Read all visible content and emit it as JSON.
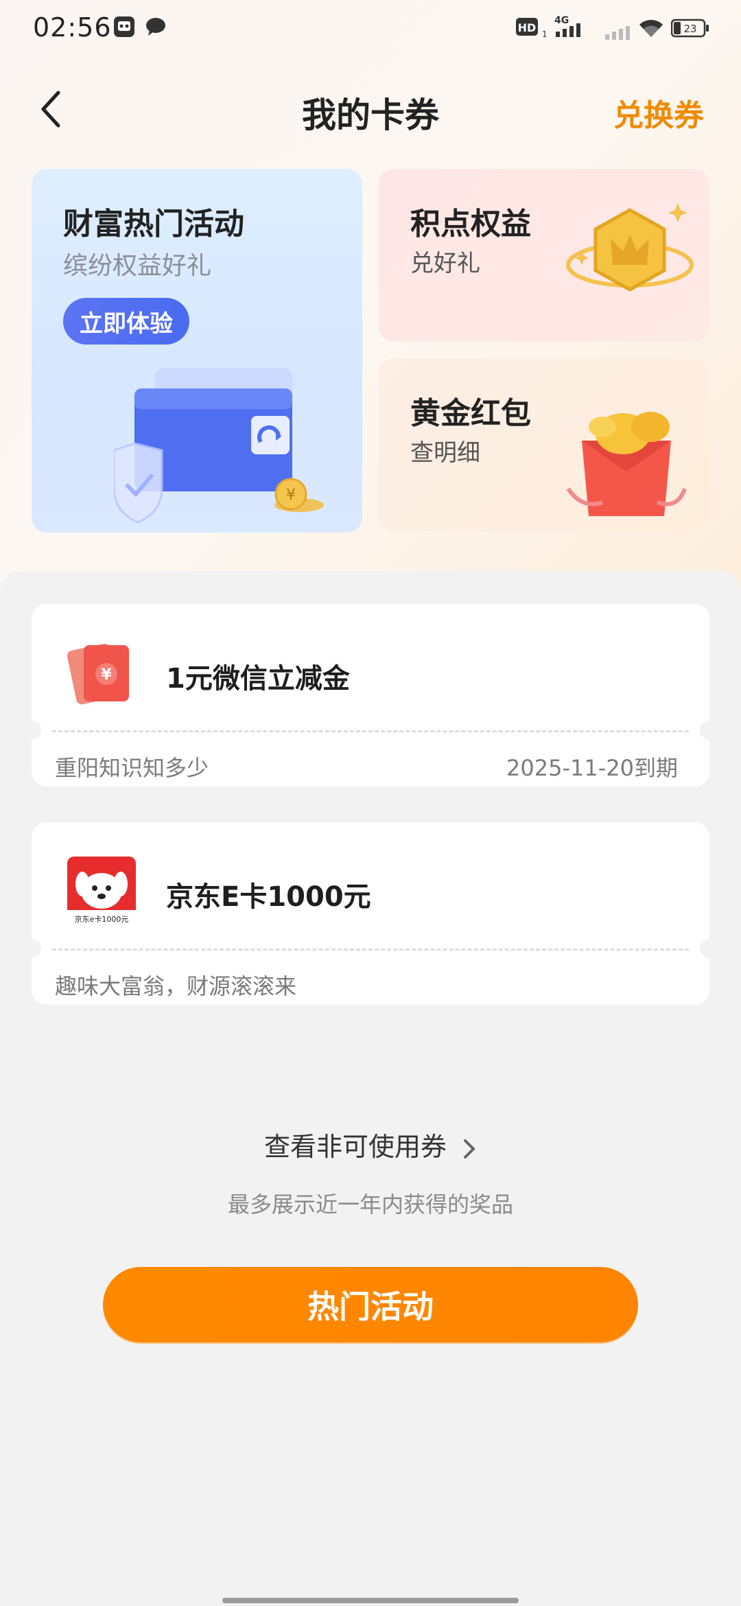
{
  "status": {
    "time": "02:56",
    "battery": "23",
    "network": "4G",
    "hd": "HD"
  },
  "header": {
    "title": "我的卡券",
    "redeem_label": "兑换券"
  },
  "promo": {
    "big": {
      "title": "财富热门活动",
      "subtitle": "缤纷权益好礼",
      "button": "立即体验"
    },
    "points": {
      "title": "积点权益",
      "subtitle": "兑好礼"
    },
    "gold": {
      "title": "黄金红包",
      "subtitle": "查明细"
    }
  },
  "coupons": [
    {
      "name": "1元微信立减金",
      "source": "重阳知识知多少",
      "expiry": "2025-11-20到期"
    },
    {
      "name": "京东E卡1000元",
      "source": "趣味大富翁，财源滚滚来",
      "expiry": "",
      "icon_caption": "京东e卡1000元"
    }
  ],
  "footer": {
    "more_label": "查看非可使用券",
    "note": "最多展示近一年内获得的奖品",
    "cta": "热门活动"
  },
  "colors": {
    "accent": "#f08a00",
    "cta": "#ff8a00",
    "blue_button": "#5c74f4"
  }
}
